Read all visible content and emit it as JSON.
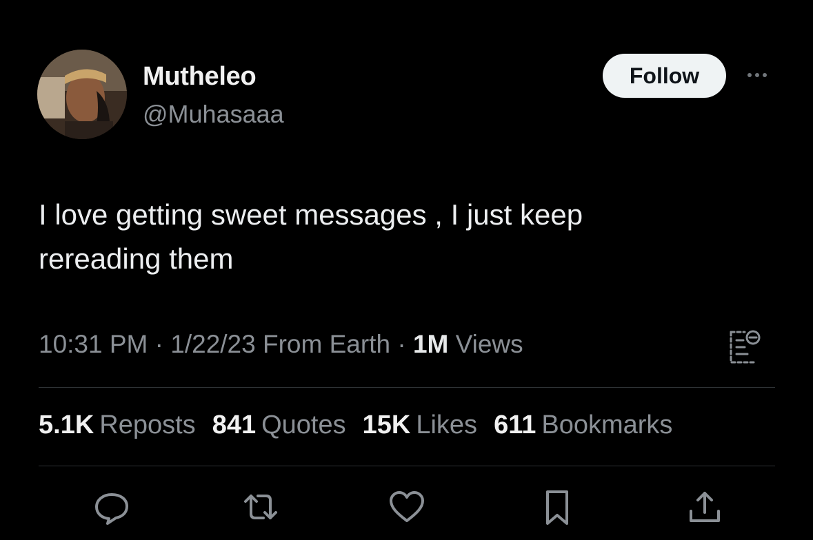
{
  "user": {
    "display_name": "Mutheleo",
    "handle": "@Muhasaaa"
  },
  "follow_label": "Follow",
  "tweet": {
    "text_line1": "I love getting sweet messages , I just keep",
    "text_line2": "rereading them"
  },
  "meta": {
    "time": "10:31 PM",
    "sep1": " · ",
    "date": "1/22/23",
    "source": " From Earth",
    "sep2": " · ",
    "views_count": "1M",
    "views_label": " Views"
  },
  "stats": [
    {
      "count": "5.1K",
      "label": "Reposts"
    },
    {
      "count": "841",
      "label": "Quotes"
    },
    {
      "count": "15K",
      "label": "Likes"
    },
    {
      "count": "611",
      "label": "Bookmarks"
    }
  ],
  "icons": {
    "more": "more-dots-icon",
    "analytics": "view-analytics-icon",
    "reply": "reply-bubble-icon",
    "repost": "repost-arrows-icon",
    "like": "heart-icon",
    "bookmark": "bookmark-icon",
    "share": "share-upload-icon"
  },
  "colors": {
    "background": "#000000",
    "text_primary": "#e7e9ea",
    "text_secondary": "#8b9096",
    "follow_button_bg": "#eff3f4",
    "divider": "#2f3336"
  }
}
